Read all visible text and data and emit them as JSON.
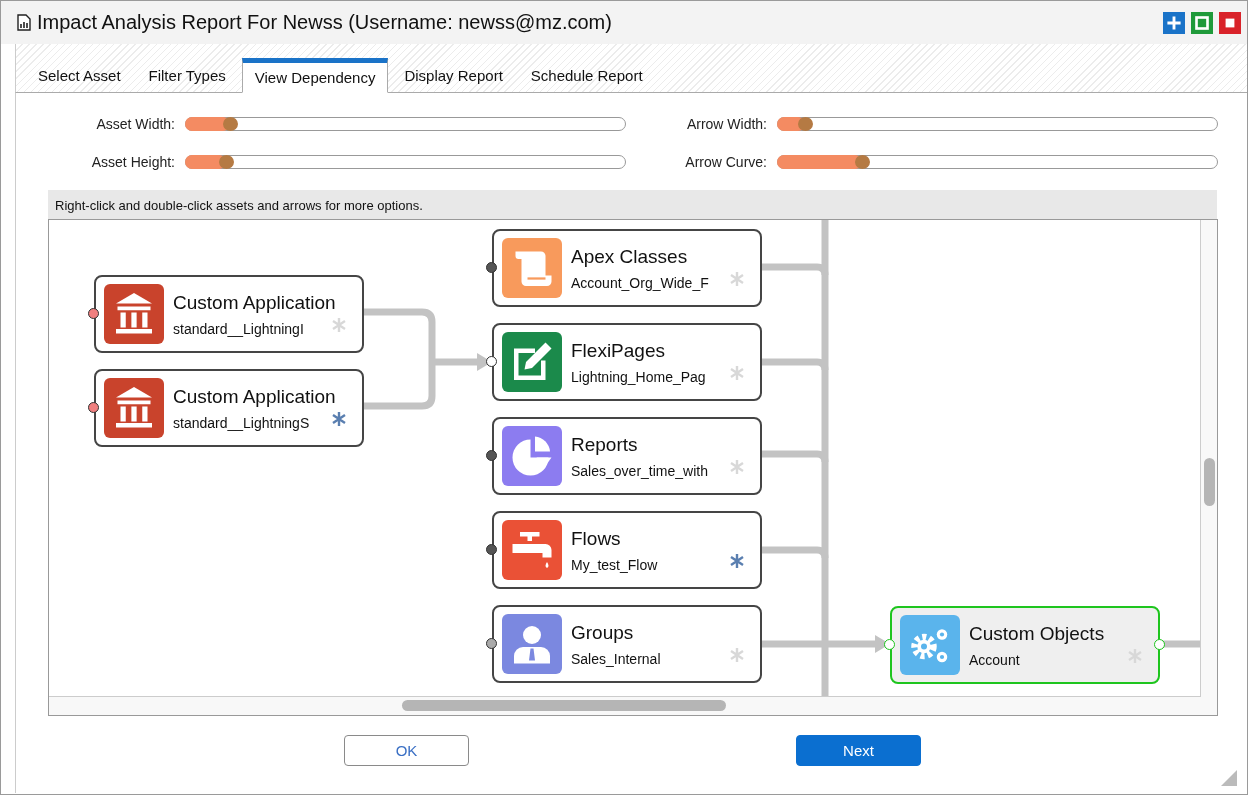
{
  "window": {
    "title": "Impact Analysis Report For Newss (Username: newss@mz.com)"
  },
  "tabs": [
    {
      "label": "Select Asset",
      "selected": false
    },
    {
      "label": "Filter Types",
      "selected": false
    },
    {
      "label": "View Dependency",
      "selected": true
    },
    {
      "label": "Display Report",
      "selected": false
    },
    {
      "label": "Schedule Report",
      "selected": false
    }
  ],
  "sliders": [
    {
      "label": "Asset Width:",
      "level": 0.08
    },
    {
      "label": "Arrow Width:",
      "level": 0.04
    },
    {
      "label": "Asset Height:",
      "level": 0.07
    },
    {
      "label": "Arrow Curve:",
      "level": 0.17
    }
  ],
  "hint": "Right-click and double-click assets and arrows for more options.",
  "nodes": [
    {
      "kind": "application",
      "title": "Custom Application",
      "subtitle": "standard__LightningI",
      "color": "#f07f7f",
      "starred": false,
      "selected": false
    },
    {
      "kind": "application",
      "title": "Custom Application",
      "subtitle": "standard__LightningS",
      "color": "#f07f7f",
      "starred": true,
      "selected": false
    },
    {
      "kind": "apex",
      "title": "Apex Classes",
      "subtitle": "Account_Org_Wide_F",
      "color": "#555555",
      "starred": false,
      "selected": false
    },
    {
      "kind": "flexipage",
      "title": "FlexiPages",
      "subtitle": "Lightning_Home_Pag",
      "color": "#ffffff",
      "starred": false,
      "selected": false
    },
    {
      "kind": "report",
      "title": "Reports",
      "subtitle": "Sales_over_time_with",
      "color": "#555555",
      "starred": false,
      "selected": false
    },
    {
      "kind": "flow",
      "title": "Flows",
      "subtitle": "My_test_Flow",
      "color": "#555555",
      "starred": true,
      "selected": false
    },
    {
      "kind": "group",
      "title": "Groups",
      "subtitle": "Sales_Internal",
      "color": "#aaaaaa",
      "starred": false,
      "selected": false
    },
    {
      "kind": "object",
      "title": "Custom Objects",
      "subtitle": "Account",
      "color": "#ffffff",
      "starred": false,
      "selected": true
    }
  ],
  "buttons": [
    {
      "label": "OK",
      "kind": "secondary"
    },
    {
      "label": "Next",
      "kind": "primary"
    }
  ]
}
